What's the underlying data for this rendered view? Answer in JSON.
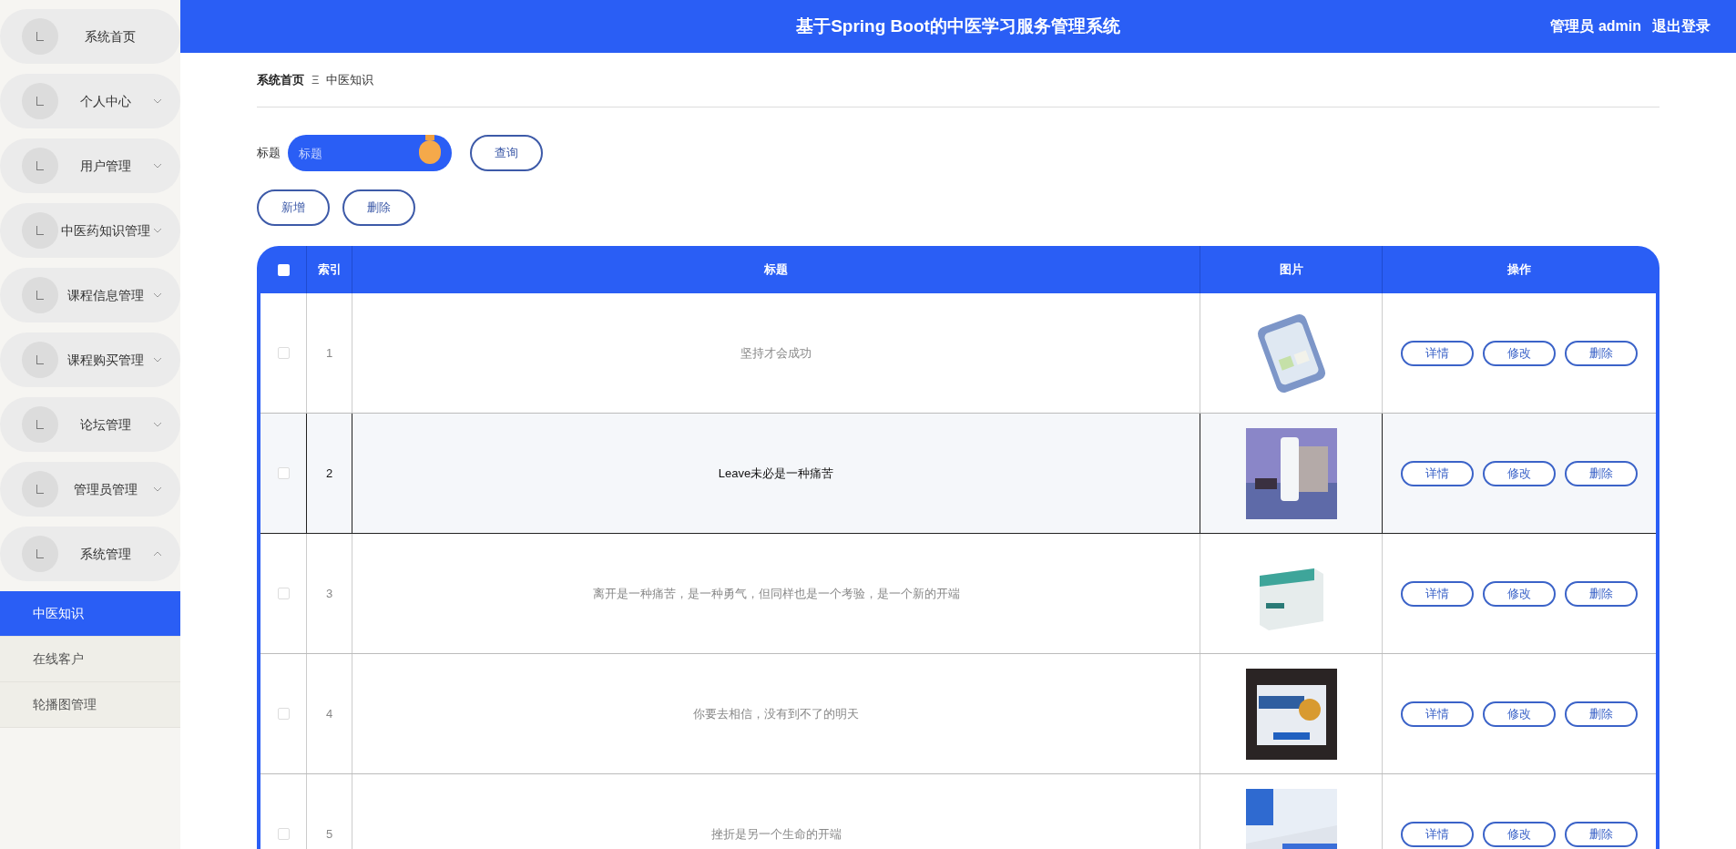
{
  "sidebar": {
    "items": [
      {
        "label": "系统首页",
        "kind": "link"
      },
      {
        "label": "个人中心",
        "kind": "menu",
        "expanded": false
      },
      {
        "label": "用户管理",
        "kind": "menu",
        "expanded": false
      },
      {
        "label": "中医药知识管理",
        "kind": "menu",
        "expanded": false
      },
      {
        "label": "课程信息管理",
        "kind": "menu",
        "expanded": false
      },
      {
        "label": "课程购买管理",
        "kind": "menu",
        "expanded": false
      },
      {
        "label": "论坛管理",
        "kind": "menu",
        "expanded": false
      },
      {
        "label": "管理员管理",
        "kind": "menu",
        "expanded": false
      },
      {
        "label": "系统管理",
        "kind": "menu",
        "expanded": true,
        "children": [
          {
            "label": "中医知识",
            "selected": true
          },
          {
            "label": "在线客户",
            "selected": false
          },
          {
            "label": "轮播图管理",
            "selected": false
          }
        ]
      }
    ]
  },
  "header": {
    "title": "基于Spring Boot的中医学习服务管理系统",
    "user": "管理员 admin",
    "logout": "退出登录"
  },
  "breadcrumb": {
    "home": "系统首页",
    "separator": "Ξ",
    "current": "中医知识"
  },
  "search": {
    "label": "标题",
    "placeholder": "标题",
    "button": "查询"
  },
  "actions": [
    "新增",
    "删除"
  ],
  "table": {
    "columns": [
      "索引",
      "标题",
      "图片",
      "操作"
    ],
    "rows": [
      {
        "index": "1",
        "title": "坚持才会成功",
        "highlighted": false,
        "checked": false,
        "actions": [
          "详情",
          "修改",
          "删除"
        ]
      },
      {
        "index": "2",
        "title": "Leave未必是一种痛苦",
        "highlighted": true,
        "checked": false,
        "actions": [
          "详情",
          "修改",
          "删除"
        ]
      },
      {
        "index": "3",
        "title": "离开是一种痛苦，是一种勇气，但同样也是一个考验，是一个新的开端",
        "highlighted": false,
        "checked": false,
        "actions": [
          "详情",
          "修改",
          "删除"
        ]
      },
      {
        "index": "4",
        "title": "你要去相信，没有到不了的明天",
        "highlighted": false,
        "checked": false,
        "actions": [
          "详情",
          "修改",
          "删除"
        ]
      },
      {
        "index": "5",
        "title": "挫折是另一个生命的开端",
        "highlighted": false,
        "checked": false,
        "actions": [
          "详情",
          "修改",
          "删除"
        ]
      }
    ],
    "select_all_checked": false
  }
}
